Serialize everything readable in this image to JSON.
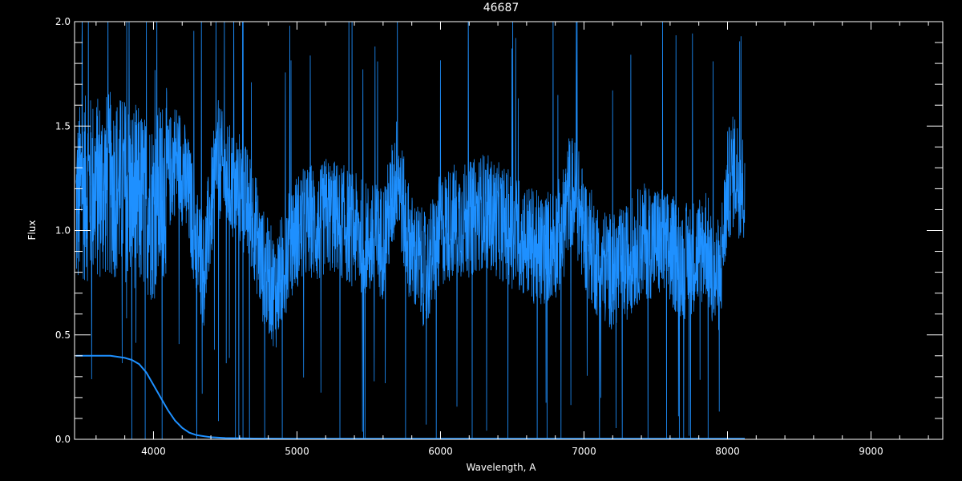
{
  "chart_data": {
    "type": "line",
    "title": "46687",
    "xlabel": "Wavelength, A",
    "ylabel": "Flux",
    "xlim": [
      3450,
      9500
    ],
    "ylim": [
      0.0,
      2.0
    ],
    "x_ticks": [
      4000,
      5000,
      6000,
      7000,
      8000,
      9000
    ],
    "x_tick_labels": [
      "4000",
      "5000",
      "6000",
      "7000",
      "8000",
      "9000"
    ],
    "y_ticks": [
      0.0,
      0.5,
      1.0,
      1.5,
      2.0
    ],
    "y_tick_labels": [
      "0.0",
      "0.5",
      "1.0",
      "1.5",
      "2.0"
    ],
    "grid": false,
    "colors": {
      "background": "#000000",
      "axes": "#ffffff",
      "series": "#1e90ff"
    },
    "series": [
      {
        "x": [
          3460,
          3500,
          3600,
          3700,
          3800,
          3900,
          4000,
          4100,
          4150,
          4200,
          4250,
          4300,
          4350,
          4400,
          4450,
          4500,
          4600,
          4700,
          4750,
          4800,
          4850,
          4900,
          4950,
          5000,
          5100,
          5150,
          5200,
          5300,
          5400,
          5500,
          5600,
          5650,
          5700,
          5750,
          5800,
          5850,
          5900,
          5950,
          6000,
          6100,
          6200,
          6300,
          6400,
          6500,
          6600,
          6700,
          6800,
          6850,
          6900,
          6950,
          7000,
          7100,
          7200,
          7300,
          7400,
          7500,
          7600,
          7700,
          7800,
          7850,
          7900,
          7950,
          8000,
          8050,
          8100,
          8120
        ],
        "y": [
          1.1,
          1.2,
          1.2,
          1.22,
          1.2,
          1.15,
          1.1,
          1.25,
          1.35,
          1.3,
          1.15,
          0.95,
          0.8,
          1.1,
          1.35,
          1.25,
          1.2,
          1.05,
          0.85,
          0.78,
          0.7,
          0.82,
          0.95,
          1.0,
          1.05,
          1.0,
          1.08,
          1.05,
          1.0,
          0.95,
          0.95,
          1.1,
          1.3,
          1.05,
          0.9,
          0.85,
          0.8,
          0.9,
          1.0,
          1.05,
          1.05,
          1.1,
          1.05,
          1.0,
          0.95,
          0.9,
          0.95,
          1.0,
          1.2,
          1.15,
          1.0,
          0.85,
          0.8,
          0.85,
          0.95,
          0.95,
          0.9,
          0.85,
          0.9,
          0.95,
          0.75,
          0.8,
          1.2,
          1.3,
          1.2,
          1.2
        ]
      },
      {
        "x": [
          3460,
          3500,
          3600,
          3700,
          3800,
          3850,
          3900,
          3950,
          4000,
          4050,
          4100,
          4150,
          4200,
          4250,
          4300,
          4400,
          4500,
          4700,
          5000,
          6000,
          7000,
          8000,
          8120
        ],
        "y": [
          0.4,
          0.4,
          0.4,
          0.4,
          0.39,
          0.38,
          0.36,
          0.32,
          0.26,
          0.2,
          0.14,
          0.09,
          0.055,
          0.032,
          0.02,
          0.01,
          0.006,
          0.004,
          0.003,
          0.003,
          0.003,
          0.003,
          0.003
        ]
      }
    ]
  }
}
